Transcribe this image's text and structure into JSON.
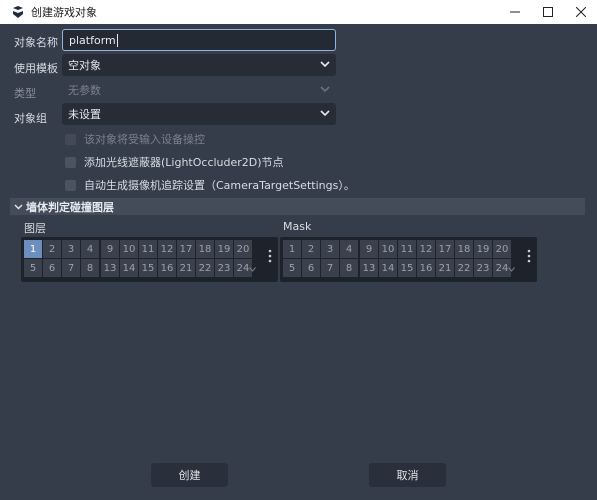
{
  "window": {
    "title": "创建游戏对象",
    "minimize_icon": "minimize-icon",
    "maximize_icon": "maximize-icon",
    "close_icon": "close-icon"
  },
  "form": {
    "name_label": "对象名称",
    "name_value": "platform",
    "template_label": "使用模板",
    "template_value": "空对象",
    "type_label": "类型",
    "type_value": "无参数",
    "group_label": "对象组",
    "group_value": "未设置"
  },
  "options": {
    "input_control_label": "该对象将受输入设备操控",
    "light_occluder_label": "添加光线遮蔽器(LightOccluder2D)节点",
    "camera_target_label": "自动生成摄像机追踪设置（CameraTargetSettings）。"
  },
  "collision": {
    "section_title": "墙体判定碰撞图层",
    "layer_title": "图层",
    "mask_title": "Mask",
    "layer_cells": [
      "1",
      "2",
      "3",
      "4",
      "5",
      "6",
      "7",
      "8",
      "9",
      "10",
      "11",
      "12",
      "13",
      "14",
      "15",
      "16",
      "17",
      "18",
      "19",
      "20",
      "21",
      "22",
      "23",
      "24"
    ],
    "mask_cells": [
      "1",
      "2",
      "3",
      "4",
      "5",
      "6",
      "7",
      "8",
      "9",
      "10",
      "11",
      "12",
      "13",
      "14",
      "15",
      "16",
      "17",
      "18",
      "19",
      "20",
      "21",
      "22",
      "23",
      "24"
    ],
    "layer_active": [
      "1"
    ],
    "mask_active": []
  },
  "buttons": {
    "create": "创建",
    "cancel": "取消"
  }
}
